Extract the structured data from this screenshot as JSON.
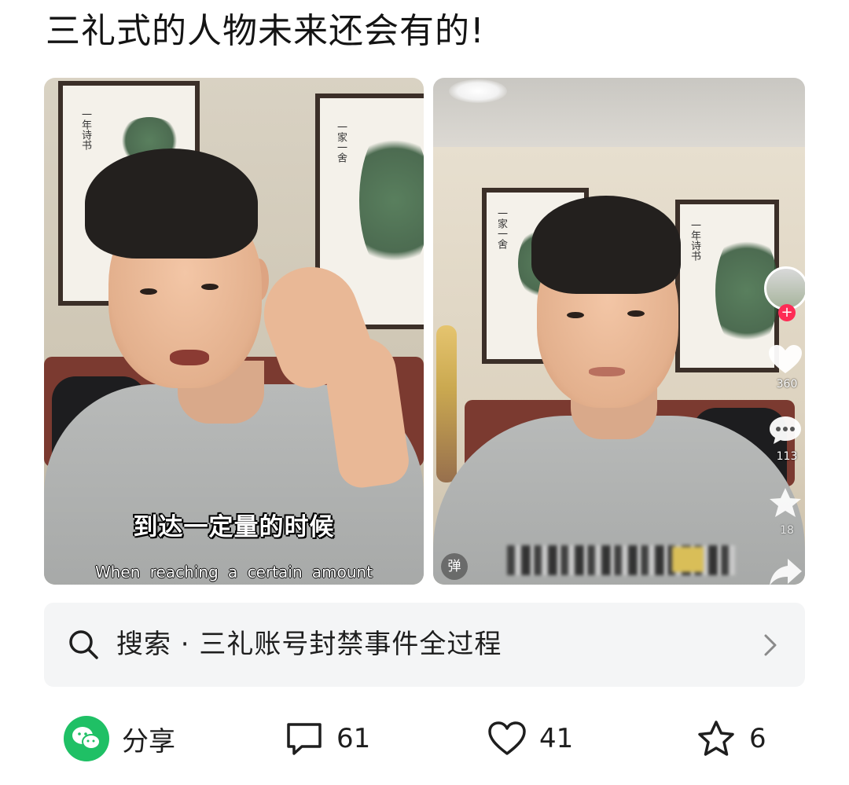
{
  "post": {
    "title": "三礼式的人物未来还会有的!"
  },
  "video_left": {
    "subtitle_cn": "到达一定量的时候",
    "subtitle_en": "When reaching a certain amount"
  },
  "video_right": {
    "like_count": "360",
    "comment_count": "113",
    "favorite_count": "18",
    "danmaku_label": "弹"
  },
  "search": {
    "text": "搜索 · 三礼账号封禁事件全过程",
    "icon": "search-icon",
    "chevron": "chevron-right-icon"
  },
  "actions": {
    "share_label": "分享",
    "comment_count": "61",
    "like_count": "41",
    "favorite_count": "6"
  },
  "colors": {
    "wechat_green": "#1fc065",
    "search_bg": "#f4f5f6",
    "text": "#1e1e1e",
    "follow_plus": "#fe2c55"
  }
}
